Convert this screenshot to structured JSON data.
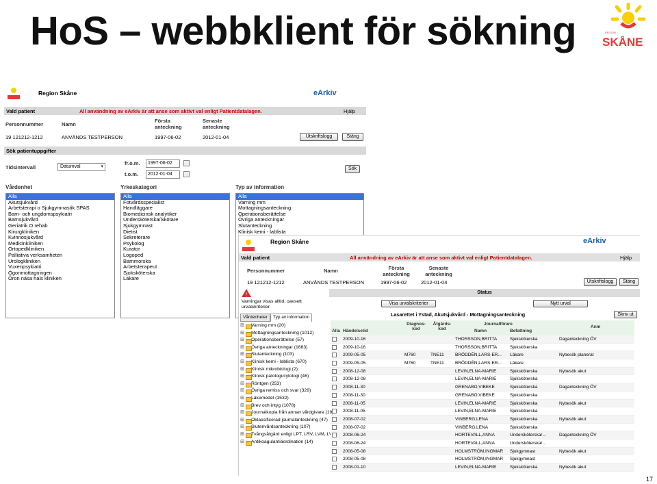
{
  "slide": {
    "title": "HoS – webbklient för sökning",
    "page_number": "17"
  },
  "logo": {
    "small_text": "REGION",
    "brand": "SKÅNE"
  },
  "win1": {
    "org": "Region Skåne",
    "app": "eArkiv",
    "bar1_left": "Vald patient",
    "bar1_warn": "All användning av eArkiv är att anse som aktivt val enligt Patientdatalagen.",
    "bar1_help": "Hjälp",
    "h_pnr": "Personnummer",
    "h_name": "Namn",
    "h_first": "Första anteckning",
    "h_last": "Senaste anteckning",
    "pnr": "19 121212-1212",
    "name": "ANVÄNDS TESTPERSON",
    "first": "1997-06-02",
    "last": "2012-01-04",
    "btn_log": "Utskriftslogg",
    "btn_close": "Stäng",
    "bar2": "Sök patientuppgifter",
    "tidsintervall": "Tidsintervall",
    "datumval": "Datumval",
    "from_lbl": "fr.o.m.",
    "from_val": "1997-06-02",
    "to_lbl": "t.o.m.",
    "to_val": "2012-01-04",
    "btn_search": "Sök",
    "col1": "Vårdenhet",
    "col2": "Yrkeskategori",
    "col3": "Typ av information",
    "list1": [
      "Alla",
      "Akutsjukvård",
      "Arbetsterapi o Sjukgymnastik SPAS",
      "Barn- och ungdomspsykiatri",
      "Barnsjukvård",
      "Geriatrik O rehab",
      "Kirurgkliniken",
      "Kvinnosjukvård",
      "Medicinkliniken",
      "Ortopedkliniken",
      "Palliativa verksamheten",
      "Urologkliniken",
      "Vuxenpsykiatri",
      "Ögonmottagningen",
      "Öron näsa hals kliniken"
    ],
    "list2": [
      "Alla",
      "Fotvårdsspecialist",
      "Handläggare",
      "Biomedicinsk analytiker",
      "Undersköterska/Skötare",
      "Sjukgymnast",
      "Dietist",
      "Sekreterare",
      "Psykolog",
      "Kurator",
      "Logoped",
      "Barnmorska",
      "Arbetsterapeut",
      "Sjuksköterska",
      "Läkare"
    ],
    "list3": [
      "Alla",
      "Varning mm",
      "Mottagningsanteckning",
      "Operationsberättelse",
      "Övriga anteckningar",
      "Slutanteckning",
      "Klinisk kemi - lablista"
    ]
  },
  "win2": {
    "org": "Region Skåne",
    "app": "eArkiv",
    "bar1_left": "Vald patient",
    "bar1_warn": "All användning av eArkiv är att anse som aktivt val enligt Patientdatalagen.",
    "bar1_help": "Hjälp",
    "h_pnr": "Personnummer",
    "h_name": "Namn",
    "h_first": "Första anteckning",
    "h_last": "Senaste anteckning",
    "pnr": "19 121212-1212",
    "name": "ANVÄNDS TESTPERSON",
    "first": "1997-06-02",
    "last": "2012-01-04",
    "btn_log": "Utskriftslogg",
    "btn_close": "Stäng",
    "warning_text": "Varningar visas alltid, oavsett urvalskriterier.",
    "tab1": "Vårdenheter",
    "tab2": "Typ av information",
    "tree": [
      "Varning mm (20)",
      "Mottagningsanteckning (1012)",
      "Operationsberättelse (57)",
      "Övriga anteckningar (1683)",
      "Slutanteckning (103)",
      "Klinisk kemi - lablista (670)",
      "Klinisk mikrobiologi (2)",
      "Klinisk patologi/cytologi (46)",
      "Röntgen (253)",
      "Övriga remiss och svar (329)",
      "Läkemedel (1532)",
      "Brev och intyg (1078)",
      "Journalkopia från annan vårdgivare (19)",
      "Oklassificerad journalanteckning (47)",
      "Slutenvårdsanteckning (107)",
      "Tvångsåtgärd enligt LPT, LRV, LVM, LVU mm (20)",
      "Antikoagulantiaordination (14)"
    ],
    "status_bar": "Status",
    "btn_show": "Visa urvalskriterier",
    "btn_new": "Nytt urval",
    "grid_title": "Lasarettet i Ystad, Akutsjukvård - Mottagningsanteckning",
    "btn_print": "Skriv ut",
    "cols": {
      "all": "Alla",
      "date": "Händelsetid",
      "diag": "Diagnos-kod",
      "atg": "Åtgärds-kod",
      "jf": "Journalförare",
      "name": "Namn",
      "bef": "Befattning",
      "anm": "Anm"
    },
    "rows": [
      [
        "2009-10-16",
        "",
        "",
        "THORSSON,BRITTA",
        "Sjuksköterska",
        "Daganteckning ÖV"
      ],
      [
        "2009-10-16",
        "",
        "",
        "THORSSON,BRITTA",
        "Sjuksköterska",
        ""
      ],
      [
        "2009-05-05",
        "M760",
        "TNE11",
        "BRÖDDÉN,LARS-ER...",
        "Läkare",
        "Nybesök planerat"
      ],
      [
        "2009-05-05",
        "M760",
        "TNE11",
        "BRÖDDÉN,LARS-ER...",
        "Läkare",
        ""
      ],
      [
        "2008-12-08",
        "",
        "",
        "LEVIN,ELNA-MARIE",
        "Sjuksköterska",
        "Nybesök akut"
      ],
      [
        "2008-12-08",
        "",
        "",
        "LEVIN,ELNA-MARIE",
        "Sjuksköterska",
        ""
      ],
      [
        "2008-11-30",
        "",
        "",
        "GRENABO,VIBEKE",
        "Sjuksköterska",
        "Daganteckning ÖV"
      ],
      [
        "2008-11-30",
        "",
        "",
        "GRENABO,VIBEKE",
        "Sjuksköterska",
        ""
      ],
      [
        "2008-11-05",
        "",
        "",
        "LEVIN,ELNA-MARIE",
        "Sjuksköterska",
        "Nybesök akut"
      ],
      [
        "2008-11-05",
        "",
        "",
        "LEVIN,ELNA-MARIE",
        "Sjuksköterska",
        ""
      ],
      [
        "2008-07-02",
        "",
        "",
        "VINBERG,LENA",
        "Sjuksköterska",
        "Nybesök akut"
      ],
      [
        "2008-07-02",
        "",
        "",
        "VINBERG,LENA",
        "Sjuksköterska",
        ""
      ],
      [
        "2008-06-24",
        "",
        "",
        "HORTEVALL,ANNA",
        "Undersköterska/...",
        "Daganteckning ÖV"
      ],
      [
        "2008-06-24",
        "",
        "",
        "HORTEVALL,ANNA",
        "Undersköterska/...",
        ""
      ],
      [
        "2008-05-08",
        "",
        "",
        "HOLMSTRÖM,INGMAR",
        "Sjukgymnast",
        "Nybesök akut"
      ],
      [
        "2008-05-08",
        "",
        "",
        "HOLMSTRÖM,INGMAR",
        "Sjukgymnast",
        ""
      ],
      [
        "2008-01-10",
        "",
        "",
        "LEVIN,ELNA-MARIE",
        "Sjuksköterska",
        "Nybesök akut"
      ]
    ]
  }
}
